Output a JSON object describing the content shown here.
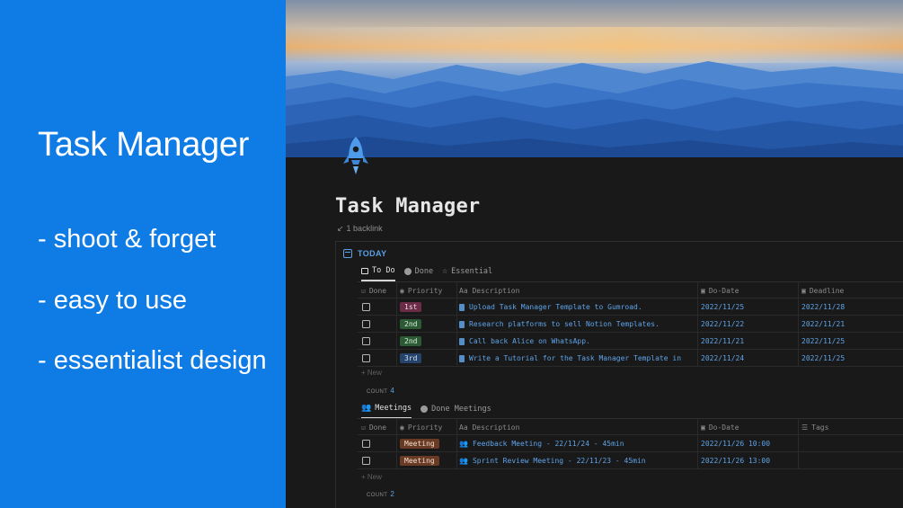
{
  "promo": {
    "title": "Task Manager",
    "features": [
      "- shoot & forget",
      "- easy to use",
      "- essentialist design"
    ],
    "bg_color": "#0f7be5"
  },
  "page": {
    "title": "Task Manager",
    "backlink": "1 backlink",
    "icon": "rocket-icon"
  },
  "today": {
    "label": "TODAY",
    "tabs": [
      "To Do",
      "Done",
      "Essential"
    ],
    "columns": {
      "done": "Done",
      "priority": "Priority",
      "description": "Aa Description",
      "do_date": "Do-Date",
      "deadline": "Deadline"
    },
    "rows": [
      {
        "priority": "1st",
        "description": "Upload Task Manager Template to Gumroad.",
        "do_date": "2022/11/25",
        "deadline": "2022/11/28"
      },
      {
        "priority": "2nd",
        "description": "Research platforms to sell Notion Templates.",
        "do_date": "2022/11/22",
        "deadline": "2022/11/21"
      },
      {
        "priority": "2nd",
        "description": "Call back Alice on WhatsApp.",
        "do_date": "2022/11/21",
        "deadline": "2022/11/25"
      },
      {
        "priority": "3rd",
        "description": "Write a Tutorial for the Task Manager Template in",
        "do_date": "2022/11/24",
        "deadline": "2022/11/25"
      }
    ],
    "new_label": "+ New",
    "count_label": "COUNT",
    "count_value": "4"
  },
  "meetings": {
    "tabs": [
      "Meetings",
      "Done Meetings"
    ],
    "columns": {
      "done": "Done",
      "priority": "Priority",
      "description": "Aa Description",
      "do_date": "Do-Date",
      "tags": "Tags"
    },
    "rows": [
      {
        "priority": "Meeting",
        "description": "Feedback Meeting - 22/11/24 - 45min",
        "do_date": "2022/11/26 10:00"
      },
      {
        "priority": "Meeting",
        "description": "Sprint Review Meeting - 22/11/23 - 45min",
        "do_date": "2022/11/26 13:00"
      }
    ],
    "new_label": "+ New",
    "count_label": "COUNT",
    "count_value": "2"
  }
}
